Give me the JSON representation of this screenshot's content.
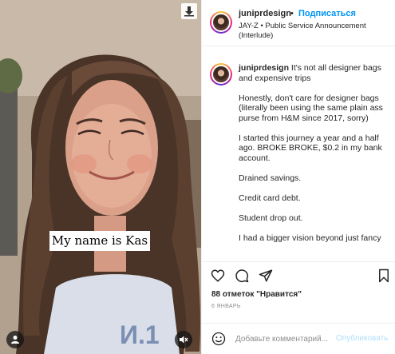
{
  "media": {
    "caption_overlay": "My name is Kas",
    "icons": [
      "download-icon",
      "user-tag-icon",
      "mute-icon"
    ]
  },
  "header": {
    "username": "juniprdesign",
    "separator": "•",
    "follow_label": "Подписаться",
    "audio": "JAY-Z • Public Service Announcement (Interlude)"
  },
  "post": {
    "username": "juniprdesign",
    "first_line": "It's not all designer bags and expensive trips",
    "paragraphs": [
      "Honestly, don't care for designer bags (literally been using the same plain ass purse from H&M since 2017, sorry)",
      "I started this journey a year and a half ago. BROKE BROKE, $0.2 in my bank account.",
      "Drained savings.",
      "Credit card debt.",
      "Student drop out.",
      "I had a bigger vision beyond just fancy"
    ]
  },
  "actions": {
    "icons": [
      "heart-icon",
      "comment-icon",
      "share-icon",
      "bookmark-icon"
    ]
  },
  "likes": "88 отметок \"Нравится\"",
  "date": "6 ЯНВАРЬ",
  "comment_box": {
    "placeholder": "Добавьте комментарий...",
    "publish_label": "Опубликовать"
  },
  "colors": {
    "accent": "#0095f6",
    "publish_disabled": "#b2dffc",
    "text": "#262626",
    "muted": "#8e8e8e",
    "divider": "#efefef"
  }
}
